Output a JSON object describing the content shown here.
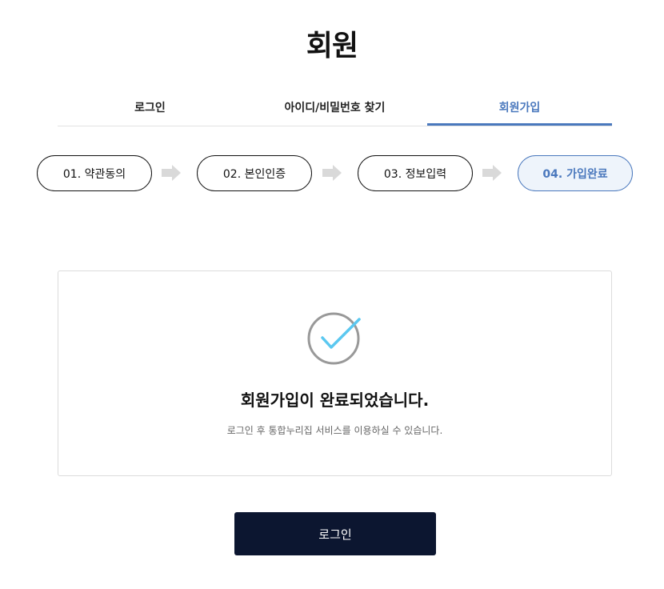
{
  "page_title": "회원",
  "tabs": [
    {
      "label": "로그인",
      "active": false
    },
    {
      "label": "아이디/비밀번호 찾기",
      "active": false
    },
    {
      "label": "회원가입",
      "active": true
    }
  ],
  "steps": [
    {
      "label": "01. 약관동의",
      "active": false
    },
    {
      "label": "02. 본인인증",
      "active": false
    },
    {
      "label": "03. 정보입력",
      "active": false
    },
    {
      "label": "04. 가입완료",
      "active": true
    }
  ],
  "result": {
    "title": "회원가입이 완료되었습니다.",
    "description": "로그인 후 통합누리집 서비스를 이용하실 수 있습니다."
  },
  "login_button_label": "로그인",
  "colors": {
    "accent": "#4a78bd",
    "check": "#5bc8f0",
    "circle": "#999999",
    "button_bg": "#0c1630",
    "arrow": "#d9d9d9"
  }
}
